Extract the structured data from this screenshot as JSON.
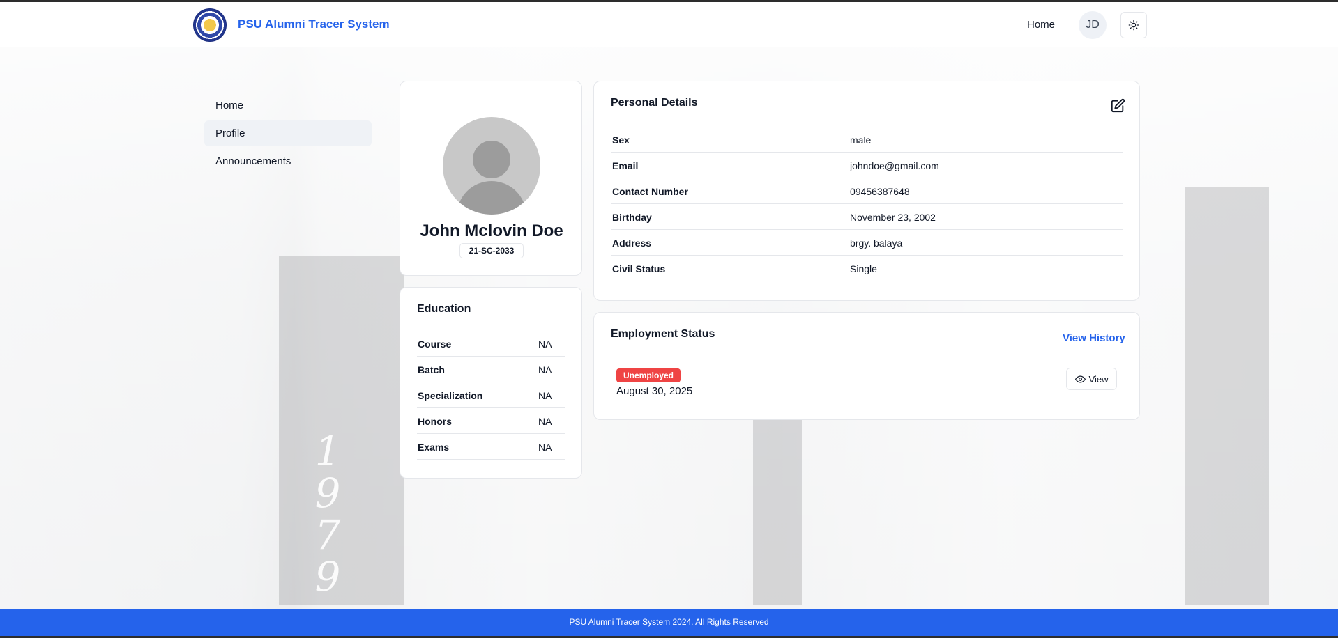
{
  "header": {
    "brand": "PSU Alumni Tracer System",
    "nav_home": "Home",
    "avatar_initials": "JD"
  },
  "sidebar": {
    "items": [
      {
        "label": "Home"
      },
      {
        "label": "Profile",
        "active": true
      },
      {
        "label": "Announcements"
      }
    ]
  },
  "profile": {
    "name": "John Mclovin Doe",
    "student_id": "21-SC-2033"
  },
  "education": {
    "title": "Education",
    "rows": [
      {
        "label": "Course",
        "value": "NA"
      },
      {
        "label": "Batch",
        "value": "NA"
      },
      {
        "label": "Specialization",
        "value": "NA"
      },
      {
        "label": "Honors",
        "value": "NA"
      },
      {
        "label": "Exams",
        "value": "NA"
      }
    ]
  },
  "personal": {
    "title": "Personal Details",
    "rows": [
      {
        "label": "Sex",
        "value": "male"
      },
      {
        "label": "Email",
        "value": "johndoe@gmail.com"
      },
      {
        "label": "Contact Number",
        "value": "09456387648"
      },
      {
        "label": "Birthday",
        "value": "November 23, 2002"
      },
      {
        "label": "Address",
        "value": "brgy. balaya"
      },
      {
        "label": "Civil Status",
        "value": "Single"
      }
    ]
  },
  "employment": {
    "title": "Employment Status",
    "view_history": "View History",
    "status": "Unemployed",
    "date": "August 30, 2025",
    "view_label": "View"
  },
  "footer": {
    "text": "PSU Alumni Tracer System 2024. All Rights Reserved"
  },
  "colors": {
    "accent": "#2563eb",
    "badge_unemployed": "#ef4444"
  }
}
